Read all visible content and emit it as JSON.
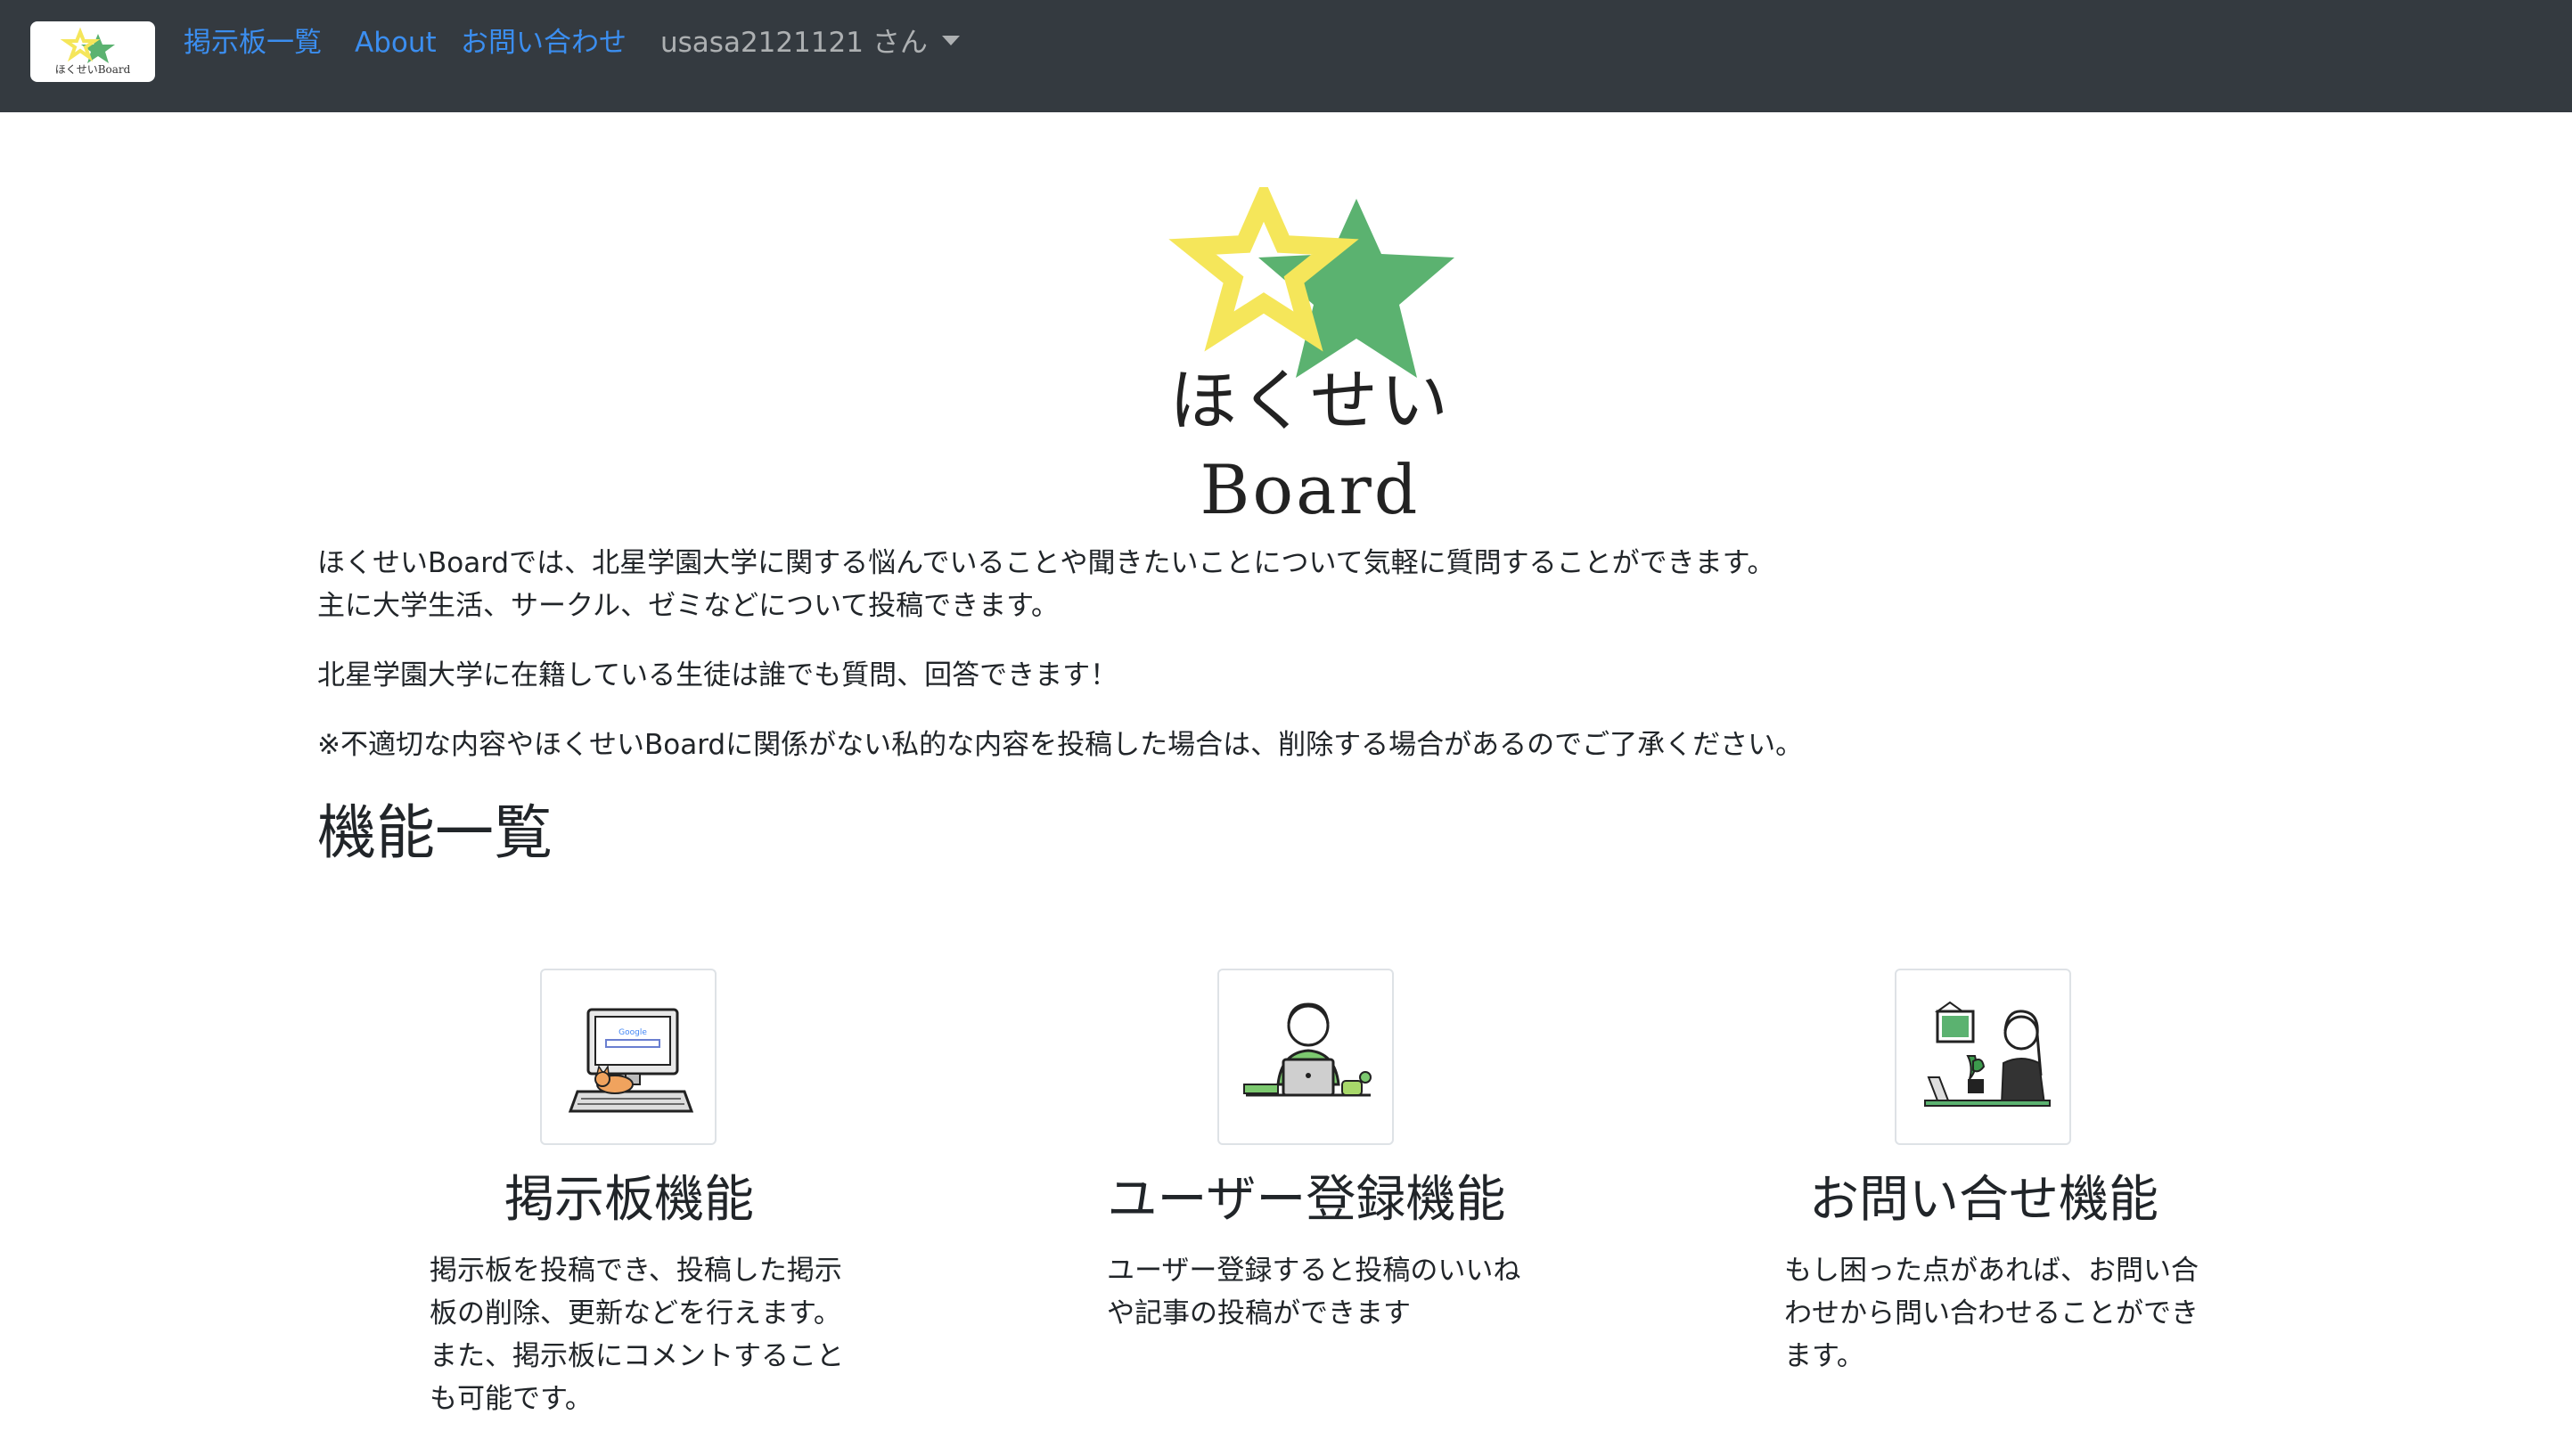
{
  "navbar": {
    "brand_text": "ほくせいBoard",
    "links": [
      "掲示板一覧",
      "About",
      "お問い合わせ"
    ],
    "user": "usasa2121121 さん"
  },
  "hero": {
    "title": "ほくせいBoard"
  },
  "intro": {
    "line1": "ほくせいBoardでは、北星学園大学に関する悩んでいることや聞きたいことについて気軽に質問することができます。",
    "line2": "主に大学生活、サークル、ゼミなどについて投稿できます。",
    "line3": "北星学園大学に在籍している生徒は誰でも質問、回答できます！",
    "line4": "※不適切な内容やほくせいBoardに関係がない私的な内容を投稿した場合は、削除する場合があるのでご了承ください。"
  },
  "features_section": {
    "title": "機能一覧",
    "items": [
      {
        "title": "掲示板機能",
        "desc": [
          "掲示板を投稿でき、投稿した掲示",
          "板の削除、更新などを行えます。",
          "また、掲示板にコメントすること",
          "も可能です。"
        ],
        "icon": "computer-with-cat-icon"
      },
      {
        "title": "ユーザー登録機能",
        "desc": [
          "ユーザー登録すると投稿のいいね",
          "や記事の投稿ができます"
        ],
        "icon": "person-at-laptop-icon"
      },
      {
        "title": "お問い合せ機能",
        "desc": [
          "もし困った点があれば、お問い合",
          "わせから問い合わせることができ",
          "ます。"
        ],
        "icon": "woman-at-desk-icon"
      }
    ]
  },
  "colors": {
    "navbar_bg": "#343a40",
    "link": "#3b8ef0",
    "star_yellow": "#f5e65a",
    "star_green": "#5bb270"
  }
}
